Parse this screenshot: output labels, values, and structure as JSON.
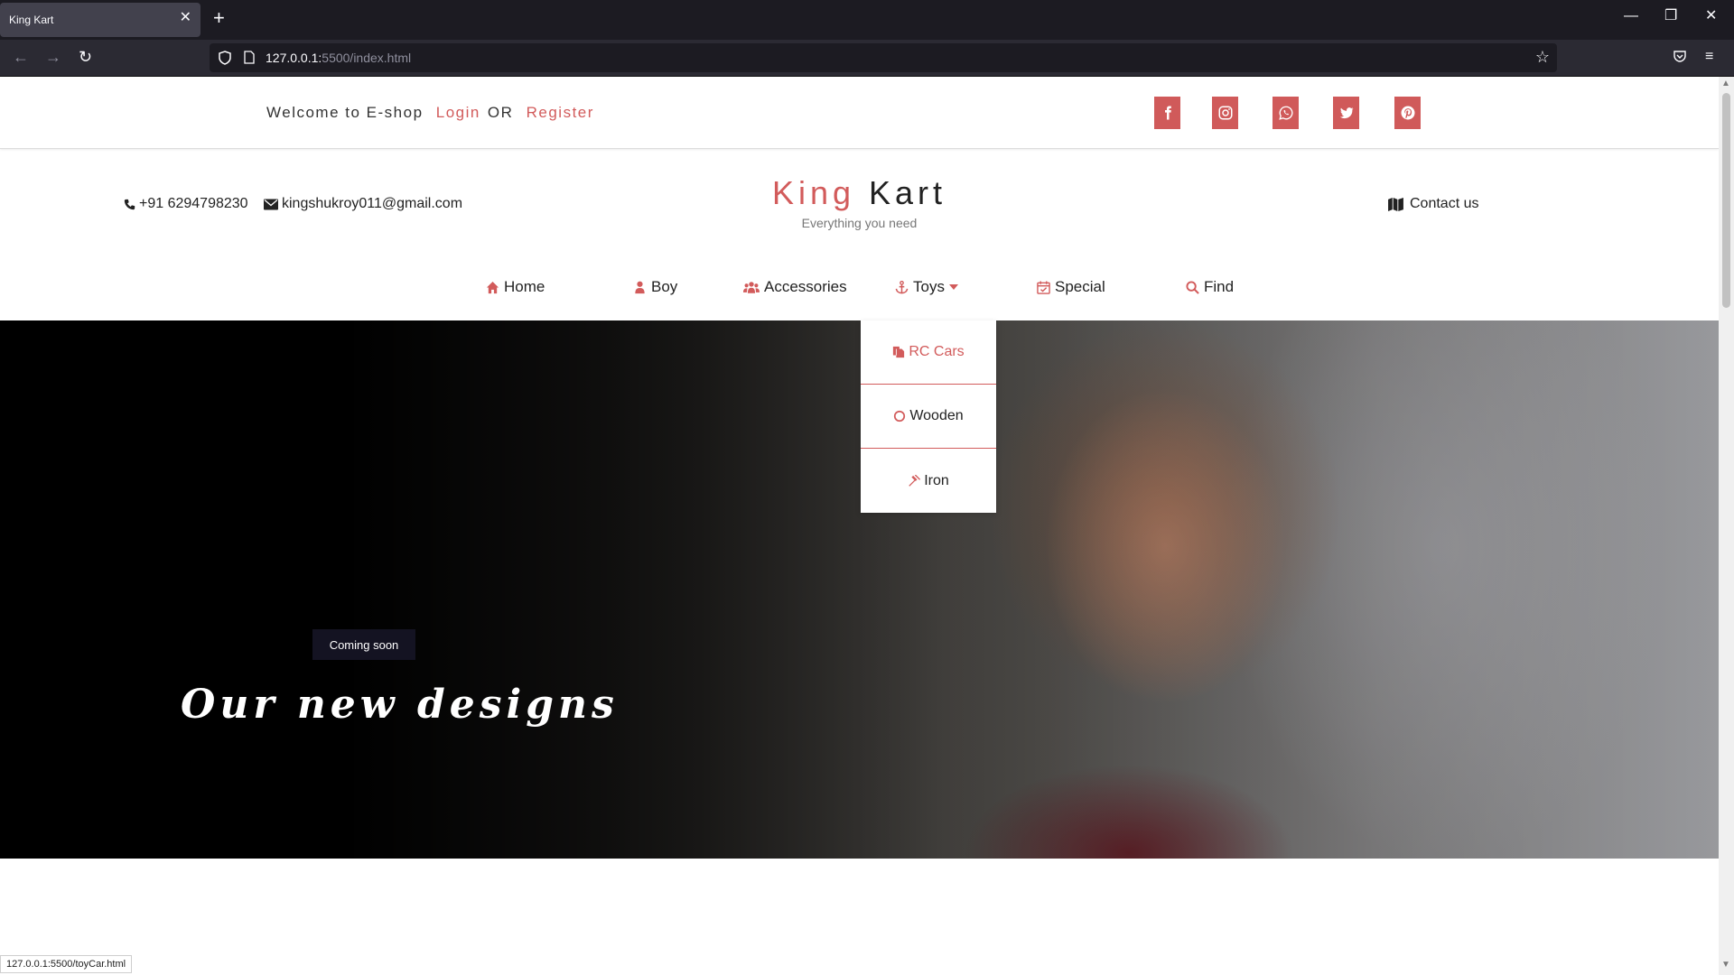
{
  "browser": {
    "tab_title": "King Kart",
    "tab_close": "✕",
    "new_tab": "+",
    "url_host": "127.0.0.1:",
    "url_rest": "5500/index.html",
    "status_url": "127.0.0.1:5500/toyCar.html"
  },
  "topbar": {
    "welcome": "Welcome to E-shop",
    "login": "Login",
    "or": "OR",
    "register": "Register"
  },
  "header": {
    "phone": "+91 6294798230",
    "email": "kingshukroy011@gmail.com",
    "brand_first": "King",
    "brand_second": "Kart",
    "tagline": "Everything you need",
    "contact": "Contact us"
  },
  "nav": {
    "home": "Home",
    "boy": "Boy",
    "accessories": "Accessories",
    "toys": "Toys",
    "special": "Special",
    "find": "Find"
  },
  "dropdown": {
    "items": [
      "RC Cars",
      "Wooden",
      "Iron"
    ]
  },
  "hero": {
    "badge": "Coming soon",
    "title": "Our new designs"
  },
  "colors": {
    "accent": "#d25b5b",
    "browser_dark": "#1c1b22",
    "toolbar": "#2b2a33",
    "badge_bg": "#141322"
  },
  "icons": {
    "social": [
      "facebook-icon",
      "instagram-icon",
      "whatsapp-icon",
      "twitter-icon",
      "pinterest-icon"
    ]
  }
}
